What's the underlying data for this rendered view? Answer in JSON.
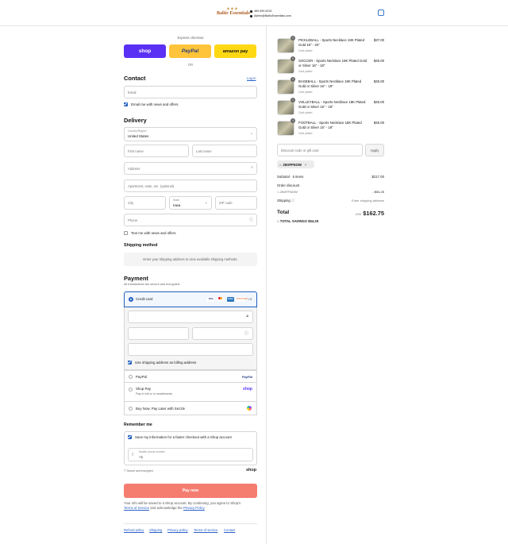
{
  "header": {
    "logo_text": "Baltic Essentials",
    "phone": "469-990-9215",
    "email": "Admin@BalticEssentials.com",
    "cart_icon": "shopping-bag-icon"
  },
  "express": {
    "title": "Express checkout",
    "shop": "shop",
    "paypal": "PayPal",
    "amazon": "amazon pay",
    "or": "OR"
  },
  "contact": {
    "heading": "Contact",
    "login": "Log in",
    "email_placeholder": "Email",
    "news_label": "Email me with news and offers"
  },
  "delivery": {
    "heading": "Delivery",
    "country_label": "Country/Region",
    "country_value": "United States",
    "first_name": "First name",
    "last_name": "Last name",
    "address": "Address",
    "apartment": "Apartment, suite, etc. (optional)",
    "city": "City",
    "state_label": "State",
    "state_value": "Iowa",
    "zip": "ZIP code",
    "phone": "Phone",
    "text_label": "Text me with news and offers"
  },
  "shipping": {
    "heading": "Shipping method",
    "note": "Enter your shipping address to view available shipping methods."
  },
  "payment": {
    "heading": "Payment",
    "note": "All transactions are secure and encrypted.",
    "credit_card": "Credit card",
    "cards": [
      "VISA",
      "MC",
      "AMEX",
      "DISCOVER"
    ],
    "more": "+3",
    "billing_label": "Use shipping address as billing address",
    "paypal": "PayPal",
    "paypal_logo": "PayPal",
    "shoppay": "Shop Pay",
    "shoppay_sub": "Pay in full or in installments",
    "shoppay_logo": "shop",
    "sezzle": "Buy Now, Pay Later with Sezzle"
  },
  "remember": {
    "heading": "Remember me",
    "save_label": "Save my information for a faster checkout with a Shop account",
    "phone_label": "Mobile phone number",
    "phone_value": "+1",
    "secure": "Secure and encrypted",
    "shop_logo": "shop"
  },
  "pay_now": "Pay now",
  "legal": {
    "text": "Your info will be saved to a Shop account. By continuing, you agree to Shop's",
    "tos": "Terms of Service",
    "and": "and acknowledge the",
    "privacy": "Privacy Policy"
  },
  "footer_links": [
    "Refund policy",
    "Shipping",
    "Privacy policy",
    "Terms of service",
    "Contact"
  ],
  "cart": {
    "items": [
      {
        "qty": "1",
        "name": "PICKLEBALL - Sports Necklace 18K Plated Gold 18\" - 20\"",
        "variant": "Gold plated",
        "price": "$37.00"
      },
      {
        "qty": "1",
        "name": "SOCCER - Sports Necklace 18K Plated Gold or Silver 16\" - 18\"",
        "variant": "Gold plated",
        "price": "$45.00"
      },
      {
        "qty": "1",
        "name": "BASEBALL - Sports Necklace 18K Plated Gold or Silver 16\" - 18\"",
        "variant": "Gold plated",
        "price": "$45.00"
      },
      {
        "qty": "1",
        "name": "VOLLEYBALL - Sports Necklace 18K Plated Gold or Silver 16\" - 18\"",
        "variant": "Gold plated",
        "price": "$45.00"
      },
      {
        "qty": "1",
        "name": "FOOTBALL - Sports Necklace 18K Plated Gold or Silver 16\" - 18\"",
        "variant": "Gold plated",
        "price": "$45.00"
      }
    ],
    "discount_placeholder": "Discount code or gift card",
    "apply": "Apply",
    "code": "25OFFNOW",
    "subtotal_label": "Subtotal · 5 items",
    "subtotal_value": "$217.00",
    "order_discount_label": "Order discount",
    "order_discount_code": "25OFFNOW",
    "order_discount_value": "- $54.25",
    "shipping_label": "Shipping",
    "shipping_value": "Enter shipping address",
    "total_label": "Total",
    "total_currency": "USD",
    "total_value": "$162.75",
    "savings_label": "TOTAL SAVINGS",
    "savings_value": "$54.25"
  },
  "colors": {
    "shop_purple": "#5a31f4",
    "paypal_yellow": "#ffc439",
    "amazon_yellow": "#ffd814",
    "accent_blue": "#1f5fbf",
    "pay_button": "#f47d70"
  }
}
